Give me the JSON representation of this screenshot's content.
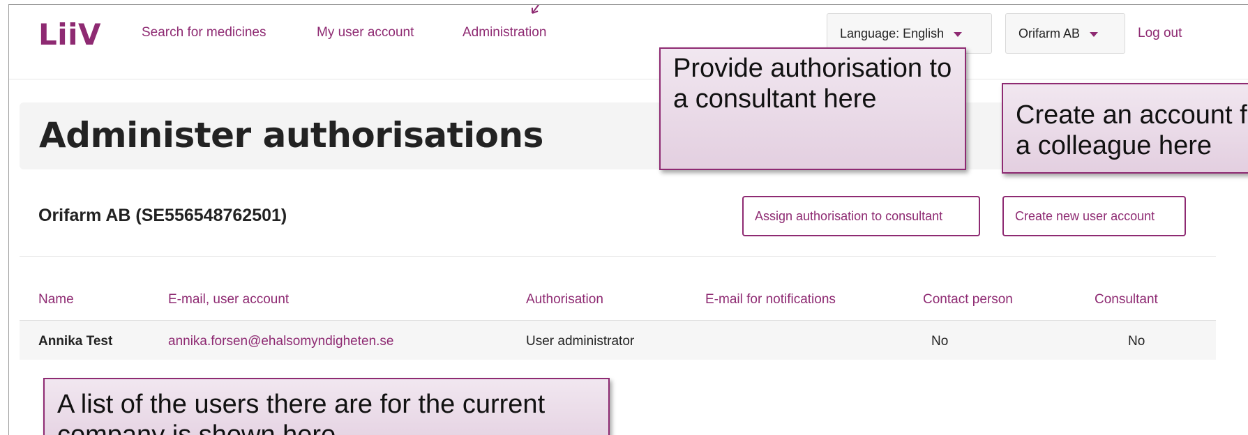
{
  "header": {
    "logo": "LiiV",
    "nav": [
      "Search for medicines",
      "My user account",
      "Administration"
    ],
    "language_select": "Language: English",
    "company_select": "Orifarm AB",
    "logout": "Log out"
  },
  "page": {
    "title": "Administer authorisations",
    "company": "Orifarm AB (SE556548762501)",
    "assign_button": "Assign authorisation to consultant",
    "create_button": "Create new user account"
  },
  "table": {
    "columns": [
      "Name",
      "E-mail, user account",
      "Authorisation",
      "E-mail for notifications",
      "Contact person",
      "Consultant"
    ],
    "rows": [
      [
        "Annika Test",
        "annika.forsen@ehalsomyndigheten.se",
        "User administrator",
        "",
        "No",
        "No"
      ]
    ]
  },
  "callouts": {
    "consultant": "Provide authorisation to a consultant here",
    "colleague": "Create an account for a colleague here",
    "users": "A list of the users there are for the current company is shown here"
  },
  "colors": {
    "accent": "#8e2a72"
  }
}
